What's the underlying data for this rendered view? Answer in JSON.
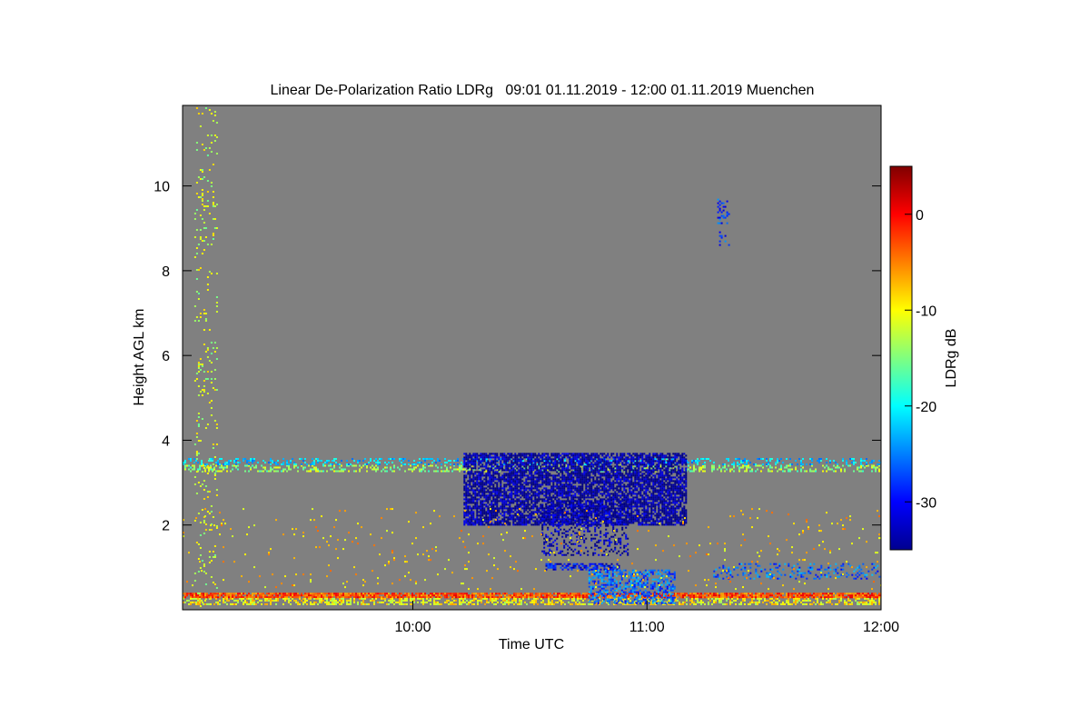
{
  "chart_data": {
    "type": "heatmap",
    "title": "Linear De-Polarization Ratio LDRg   09:01 01.11.2019 - 12:00 01.11.2019 Muenchen",
    "xlabel": "Time UTC",
    "ylabel": "Height AGL km",
    "xlim": [
      "09:01",
      "12:00"
    ],
    "ylim": [
      0,
      11.9
    ],
    "x_ticks": [
      "10:00",
      "11:00",
      "12:00"
    ],
    "y_ticks": [
      2,
      4,
      6,
      8,
      10
    ],
    "background_color": "#808080",
    "colorbar": {
      "label": "LDRg dB",
      "range": [
        -35,
        5
      ],
      "ticks": [
        0,
        -10,
        -20,
        -30
      ],
      "colormap": "jet"
    },
    "features": [
      {
        "t0": "09:04",
        "t1": "09:10",
        "h0": 0.1,
        "h1": 11.9,
        "ldr": -12,
        "density": 0.08
      },
      {
        "t0": "09:01",
        "t1": "12:00",
        "h0": 0.28,
        "h1": 0.4,
        "ldr": -3,
        "density": 0.9
      },
      {
        "t0": "09:01",
        "t1": "12:00",
        "h0": 0.12,
        "h1": 0.28,
        "ldr": -10,
        "density": 0.5
      },
      {
        "t0": "09:01",
        "t1": "12:00",
        "h0": 3.28,
        "h1": 3.42,
        "ldr": -14,
        "density": 0.35
      },
      {
        "t0": "09:01",
        "t1": "12:00",
        "h0": 3.42,
        "h1": 3.58,
        "ldr": -22,
        "density": 0.3
      },
      {
        "t0": "10:13",
        "t1": "11:10",
        "h0": 2.0,
        "h1": 3.7,
        "ldr": -34,
        "density": 0.75
      },
      {
        "t0": "10:33",
        "t1": "10:55",
        "h0": 1.3,
        "h1": 2.6,
        "ldr": -33,
        "density": 0.3
      },
      {
        "t0": "10:34",
        "t1": "10:53",
        "h0": 0.95,
        "h1": 1.1,
        "ldr": -30,
        "density": 0.6
      },
      {
        "t0": "10:45",
        "t1": "11:07",
        "h0": 0.15,
        "h1": 0.95,
        "ldr": -26,
        "density": 0.5
      },
      {
        "t0": "11:18",
        "t1": "11:21",
        "h0": 8.6,
        "h1": 9.7,
        "ldr": -28,
        "density": 0.2
      },
      {
        "t0": "11:17",
        "t1": "12:00",
        "h0": 0.75,
        "h1": 1.1,
        "ldr": -26,
        "density": 0.25
      },
      {
        "t0": "09:01",
        "t1": "12:00",
        "h0": 0.5,
        "h1": 2.4,
        "ldr": -8,
        "density": 0.02
      }
    ]
  }
}
